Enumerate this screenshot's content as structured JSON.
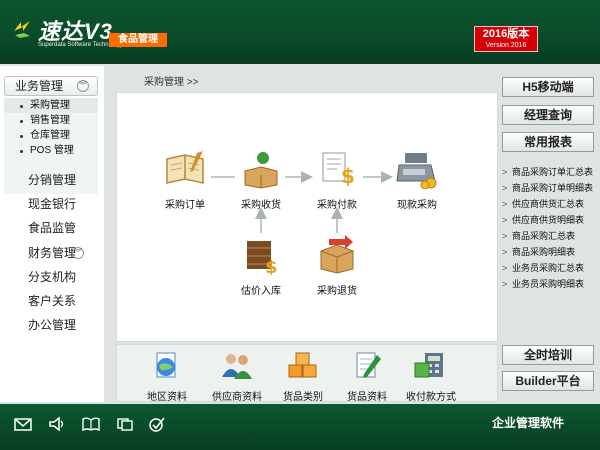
{
  "header": {
    "brand_name": "速达V3",
    "brand_sub": "Superdata Software Technology",
    "module": "食品管理",
    "version_line1": "2016版本",
    "version_line2": "Version 2016"
  },
  "sidebar": {
    "group_title": "业务管理",
    "sub_items": [
      "采购管理",
      "销售管理",
      "仓库管理",
      "POS 管理"
    ],
    "items": [
      "分销管理",
      "现金银行",
      "食品监管"
    ],
    "finance": "财务管理",
    "items2": [
      "分支机构",
      "客户关系",
      "办公管理"
    ]
  },
  "breadcrumb": "采购管理 >>",
  "workflow": {
    "order": "采购订单",
    "receive": "采购收货",
    "pay": "采购付款",
    "cash": "现款采购",
    "estimate": "估价入库",
    "return": "采购退货"
  },
  "tools": [
    "地区资料",
    "供应商资料",
    "货品类别",
    "货品资料",
    "收付款方式"
  ],
  "right": {
    "btn_mobile": "H5移动端",
    "btn_manager": "经理查询",
    "btn_reports": "常用报表",
    "reports": [
      "商品采购订单汇总表",
      "商品采购订单明细表",
      "供应商供货汇总表",
      "供应商供货明细表",
      "商品采购汇总表",
      "商品采购明细表",
      "业务员采购汇总表",
      "业务员采购明细表"
    ],
    "btn_training": "全时培训",
    "btn_builder": "Builder平台"
  },
  "footer": {
    "text": "企业管理软件"
  },
  "colors": {
    "header": "#0b5530",
    "accent": "#ff6a00",
    "version": "#d40008",
    "footer": "#073d22"
  }
}
